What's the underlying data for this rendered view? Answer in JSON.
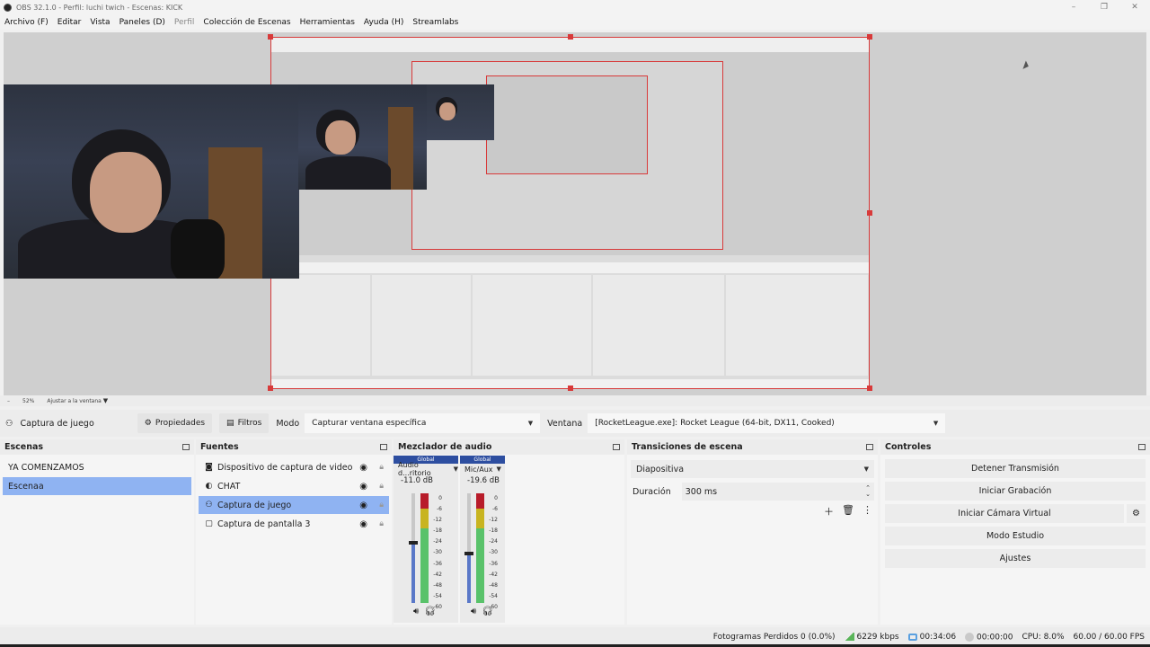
{
  "window": {
    "title": "OBS 32.1.0 - Perfil: luchi twich - Escenas: KICK",
    "minimize": "–",
    "maximize": "❐",
    "close": "✕"
  },
  "menu": {
    "items": [
      "Archivo (F)",
      "Editar",
      "Vista",
      "Paneles (D)",
      "Perfil",
      "Colección de Escenas",
      "Herramientas",
      "Ayuda (H)",
      "Streamlabs"
    ]
  },
  "zoom": {
    "minus": "–",
    "value": "52%",
    "fit_label": "Ajustar a la ventana"
  },
  "source_toolbar": {
    "source_name": "Captura de juego",
    "properties_label": "Propiedades",
    "filters_label": "Filtros",
    "mode_label": "Modo",
    "mode_value": "Capturar ventana específica",
    "window_label": "Ventana",
    "window_value": "[RocketLeague.exe]: Rocket League (64-bit, DX11, Cooked)"
  },
  "scenes": {
    "title": "Escenas",
    "items": [
      "YA COMENZAMOS",
      "Escenaa"
    ],
    "selected": 1
  },
  "sources": {
    "title": "Fuentes",
    "items": [
      {
        "label": "Dispositivo de captura de video",
        "icon": "camera-icon"
      },
      {
        "label": "CHAT",
        "icon": "browser-icon"
      },
      {
        "label": "Captura de juego",
        "icon": "gamepad-icon"
      },
      {
        "label": "Captura de pantalla 3",
        "icon": "monitor-icon"
      }
    ],
    "selected": 2
  },
  "mixer": {
    "title": "Mezclador de audio",
    "channels": [
      {
        "tag": "Global",
        "name": "Audio d...ritorio",
        "db": "-11.0 dB",
        "fader_level": 0.55
      },
      {
        "tag": "Global",
        "name": "Mic/Aux",
        "db": "-19.6 dB",
        "fader_level": 0.45
      }
    ],
    "scale": [
      "0",
      "-6",
      "-12",
      "-18",
      "-24",
      "-30",
      "-36",
      "-42",
      "-48",
      "-54",
      "-60"
    ]
  },
  "transitions": {
    "title": "Transiciones de escena",
    "selected": "Diapositiva",
    "duration_label": "Duración",
    "duration_value": "300 ms"
  },
  "controls": {
    "title": "Controles",
    "stop_stream": "Detener Transmisión",
    "start_recording": "Iniciar Grabación",
    "start_virtual_cam": "Iniciar Cámara Virtual",
    "studio_mode": "Modo Estudio",
    "settings": "Ajustes"
  },
  "status": {
    "dropped_frames": "Fotogramas Perdidos 0 (0.0%)",
    "bitrate": "6229 kbps",
    "stream_time": "00:34:06",
    "record_time": "00:00:00",
    "cpu": "CPU: 8.0%",
    "fps": "60.00 / 60.00 FPS"
  },
  "colors": {
    "selection": "#8fb3f2",
    "preview_border": "#d83a3a",
    "mixer_tag": "#2d4ea0"
  }
}
